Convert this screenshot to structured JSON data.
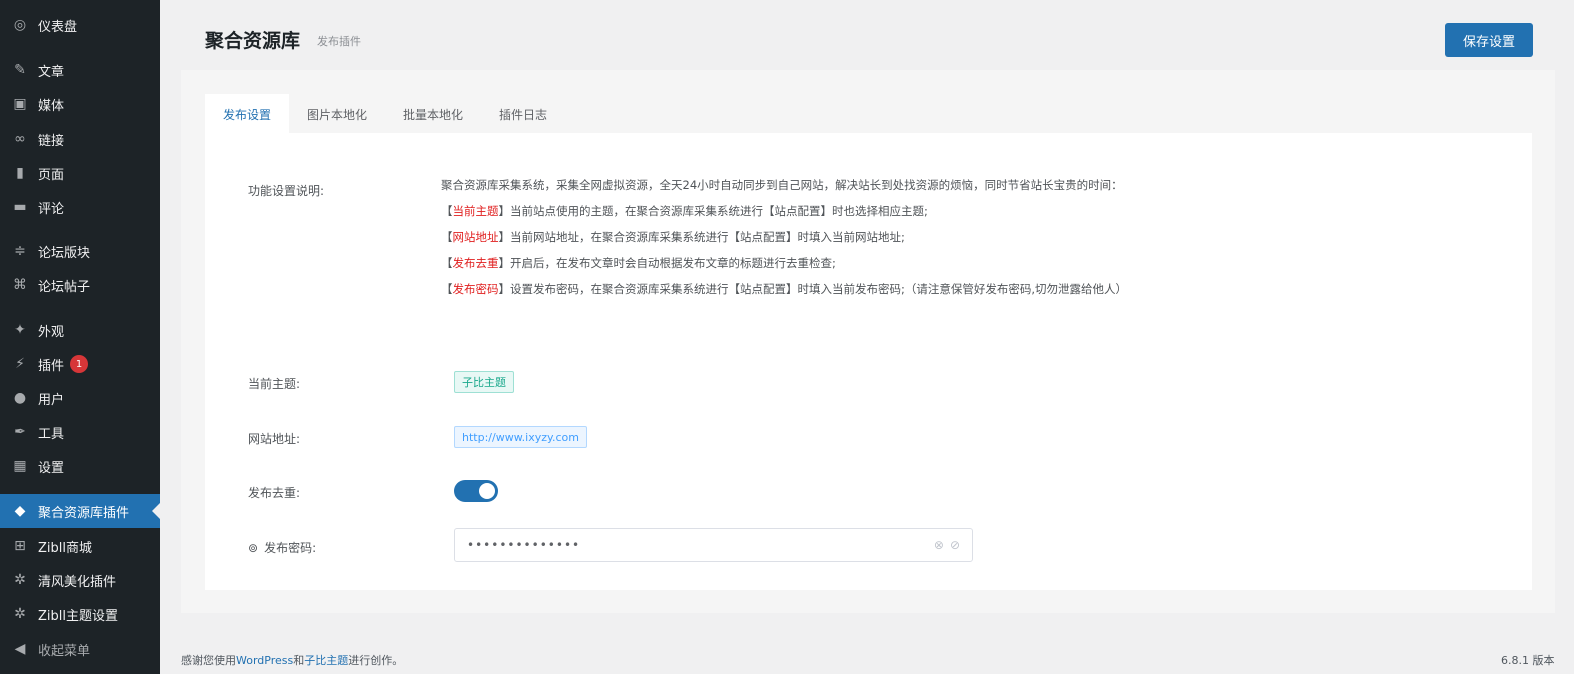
{
  "sidebar": {
    "items": [
      {
        "label": "仪表盘",
        "icon": "dashboard-icon",
        "glyph": "◎"
      },
      {
        "label": "文章",
        "icon": "pin-icon",
        "glyph": "✎"
      },
      {
        "label": "媒体",
        "icon": "media-icon",
        "glyph": "▣"
      },
      {
        "label": "链接",
        "icon": "link-icon",
        "glyph": "∞"
      },
      {
        "label": "页面",
        "icon": "page-icon",
        "glyph": "▮"
      },
      {
        "label": "评论",
        "icon": "comment-icon",
        "glyph": "▬"
      },
      {
        "label": "论坛版块",
        "icon": "forum-icon",
        "glyph": "≑"
      },
      {
        "label": "论坛帖子",
        "icon": "forum-post-icon",
        "glyph": "⌘"
      },
      {
        "label": "外观",
        "icon": "appearance-icon",
        "glyph": "✦"
      },
      {
        "label": "插件",
        "icon": "plugin-icon",
        "glyph": "⚡",
        "badge": "1"
      },
      {
        "label": "用户",
        "icon": "user-icon",
        "glyph": "●"
      },
      {
        "label": "工具",
        "icon": "tool-icon",
        "glyph": "✒"
      },
      {
        "label": "设置",
        "icon": "settings-icon",
        "glyph": "▦"
      },
      {
        "label": "聚合资源库插件",
        "icon": "shield-icon",
        "glyph": "◆"
      },
      {
        "label": "Zibll商城",
        "icon": "cart-icon",
        "glyph": "⊞"
      },
      {
        "label": "清风美化插件",
        "icon": "gear-icon",
        "glyph": "✲"
      },
      {
        "label": "Zibll主题设置",
        "icon": "gear-icon",
        "glyph": "✲"
      },
      {
        "label": "收起菜单",
        "icon": "collapse-icon",
        "glyph": "◀"
      }
    ]
  },
  "header": {
    "title": "聚合资源库",
    "subtitle": "发布插件",
    "save_label": "保存设置"
  },
  "tabs": [
    "发布设置",
    "图片本地化",
    "批量本地化",
    "插件日志"
  ],
  "form": {
    "desc_label": "功能设置说明:",
    "desc_intro": "聚合资源库采集系统，采集全网虚拟资源，全天24小时自动同步到自己网站，解决站长到处找资源的烦恼，同时节省站长宝贵的时间：",
    "desc_lines": [
      {
        "open": "【",
        "key": "当前主题",
        "close": "】",
        "text": "当前站点使用的主题，在聚合资源库采集系统进行【站点配置】时也选择相应主题;"
      },
      {
        "open": "【",
        "key": "网站地址",
        "close": "】",
        "text": "当前网站地址，在聚合资源库采集系统进行【站点配置】时填入当前网站地址;"
      },
      {
        "open": "【",
        "key": "发布去重",
        "close": "】",
        "text": "开启后，在发布文章时会自动根据发布文章的标题进行去重检查;"
      },
      {
        "open": "【",
        "key": "发布密码",
        "close": "】",
        "text": "设置发布密码，在聚合资源库采集系统进行【站点配置】时填入当前发布密码;（请注意保管好发布密码,切勿泄露给他人）"
      }
    ],
    "theme_label": "当前主题:",
    "theme_value": "子比主题",
    "site_label": "网站地址:",
    "site_value": "http://www.ixyzy.com",
    "dedupe_label": "发布去重:",
    "dedupe_on": true,
    "password_label": "发布密码:",
    "password_value": "••••••••••••••"
  },
  "footer": {
    "prefix": "感谢您使用",
    "wp_link": "WordPress",
    "and": "和",
    "theme_link": "子比主题",
    "suffix": "进行创作。",
    "version": "6.8.1 版本"
  }
}
